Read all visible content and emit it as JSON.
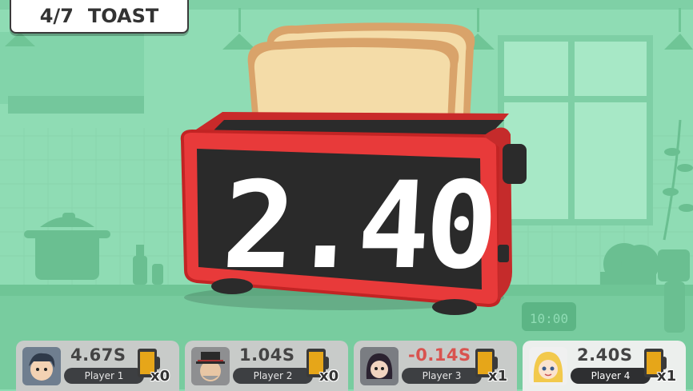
{
  "round": {
    "progress": "4/7",
    "item": "TOAST"
  },
  "timer": {
    "display": "2.40"
  },
  "players": [
    {
      "time": "4.67S",
      "name": "Player 1",
      "count": "x0",
      "negative": false,
      "active": false
    },
    {
      "time": "1.04S",
      "name": "Player 2",
      "count": "x0",
      "negative": false,
      "active": false
    },
    {
      "time": "-0.14S",
      "name": "Player 3",
      "count": "x1",
      "negative": true,
      "active": false
    },
    {
      "time": "2.40S",
      "name": "Player 4",
      "count": "x1",
      "negative": false,
      "active": true
    }
  ],
  "colors": {
    "background": "#8fdcb4",
    "toaster": "#e83a3a",
    "negative_time": "#d9534f",
    "jar": "#e6a619"
  },
  "icons": {
    "kitchen_clock_label": "10:00"
  }
}
